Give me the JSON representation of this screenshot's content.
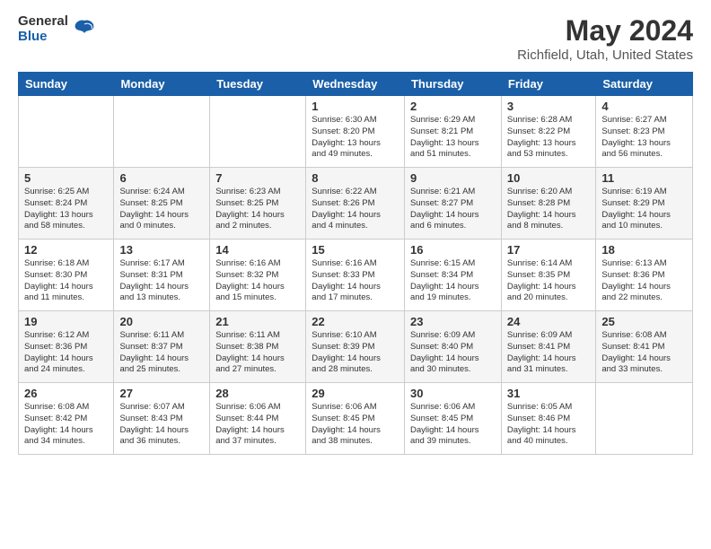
{
  "header": {
    "logo_general": "General",
    "logo_blue": "Blue",
    "month_year": "May 2024",
    "location": "Richfield, Utah, United States"
  },
  "days_of_week": [
    "Sunday",
    "Monday",
    "Tuesday",
    "Wednesday",
    "Thursday",
    "Friday",
    "Saturday"
  ],
  "weeks": [
    [
      {
        "day": "",
        "info": ""
      },
      {
        "day": "",
        "info": ""
      },
      {
        "day": "",
        "info": ""
      },
      {
        "day": "1",
        "info": "Sunrise: 6:30 AM\nSunset: 8:20 PM\nDaylight: 13 hours\nand 49 minutes."
      },
      {
        "day": "2",
        "info": "Sunrise: 6:29 AM\nSunset: 8:21 PM\nDaylight: 13 hours\nand 51 minutes."
      },
      {
        "day": "3",
        "info": "Sunrise: 6:28 AM\nSunset: 8:22 PM\nDaylight: 13 hours\nand 53 minutes."
      },
      {
        "day": "4",
        "info": "Sunrise: 6:27 AM\nSunset: 8:23 PM\nDaylight: 13 hours\nand 56 minutes."
      }
    ],
    [
      {
        "day": "5",
        "info": "Sunrise: 6:25 AM\nSunset: 8:24 PM\nDaylight: 13 hours\nand 58 minutes."
      },
      {
        "day": "6",
        "info": "Sunrise: 6:24 AM\nSunset: 8:25 PM\nDaylight: 14 hours\nand 0 minutes."
      },
      {
        "day": "7",
        "info": "Sunrise: 6:23 AM\nSunset: 8:25 PM\nDaylight: 14 hours\nand 2 minutes."
      },
      {
        "day": "8",
        "info": "Sunrise: 6:22 AM\nSunset: 8:26 PM\nDaylight: 14 hours\nand 4 minutes."
      },
      {
        "day": "9",
        "info": "Sunrise: 6:21 AM\nSunset: 8:27 PM\nDaylight: 14 hours\nand 6 minutes."
      },
      {
        "day": "10",
        "info": "Sunrise: 6:20 AM\nSunset: 8:28 PM\nDaylight: 14 hours\nand 8 minutes."
      },
      {
        "day": "11",
        "info": "Sunrise: 6:19 AM\nSunset: 8:29 PM\nDaylight: 14 hours\nand 10 minutes."
      }
    ],
    [
      {
        "day": "12",
        "info": "Sunrise: 6:18 AM\nSunset: 8:30 PM\nDaylight: 14 hours\nand 11 minutes."
      },
      {
        "day": "13",
        "info": "Sunrise: 6:17 AM\nSunset: 8:31 PM\nDaylight: 14 hours\nand 13 minutes."
      },
      {
        "day": "14",
        "info": "Sunrise: 6:16 AM\nSunset: 8:32 PM\nDaylight: 14 hours\nand 15 minutes."
      },
      {
        "day": "15",
        "info": "Sunrise: 6:16 AM\nSunset: 8:33 PM\nDaylight: 14 hours\nand 17 minutes."
      },
      {
        "day": "16",
        "info": "Sunrise: 6:15 AM\nSunset: 8:34 PM\nDaylight: 14 hours\nand 19 minutes."
      },
      {
        "day": "17",
        "info": "Sunrise: 6:14 AM\nSunset: 8:35 PM\nDaylight: 14 hours\nand 20 minutes."
      },
      {
        "day": "18",
        "info": "Sunrise: 6:13 AM\nSunset: 8:36 PM\nDaylight: 14 hours\nand 22 minutes."
      }
    ],
    [
      {
        "day": "19",
        "info": "Sunrise: 6:12 AM\nSunset: 8:36 PM\nDaylight: 14 hours\nand 24 minutes."
      },
      {
        "day": "20",
        "info": "Sunrise: 6:11 AM\nSunset: 8:37 PM\nDaylight: 14 hours\nand 25 minutes."
      },
      {
        "day": "21",
        "info": "Sunrise: 6:11 AM\nSunset: 8:38 PM\nDaylight: 14 hours\nand 27 minutes."
      },
      {
        "day": "22",
        "info": "Sunrise: 6:10 AM\nSunset: 8:39 PM\nDaylight: 14 hours\nand 28 minutes."
      },
      {
        "day": "23",
        "info": "Sunrise: 6:09 AM\nSunset: 8:40 PM\nDaylight: 14 hours\nand 30 minutes."
      },
      {
        "day": "24",
        "info": "Sunrise: 6:09 AM\nSunset: 8:41 PM\nDaylight: 14 hours\nand 31 minutes."
      },
      {
        "day": "25",
        "info": "Sunrise: 6:08 AM\nSunset: 8:41 PM\nDaylight: 14 hours\nand 33 minutes."
      }
    ],
    [
      {
        "day": "26",
        "info": "Sunrise: 6:08 AM\nSunset: 8:42 PM\nDaylight: 14 hours\nand 34 minutes."
      },
      {
        "day": "27",
        "info": "Sunrise: 6:07 AM\nSunset: 8:43 PM\nDaylight: 14 hours\nand 36 minutes."
      },
      {
        "day": "28",
        "info": "Sunrise: 6:06 AM\nSunset: 8:44 PM\nDaylight: 14 hours\nand 37 minutes."
      },
      {
        "day": "29",
        "info": "Sunrise: 6:06 AM\nSunset: 8:45 PM\nDaylight: 14 hours\nand 38 minutes."
      },
      {
        "day": "30",
        "info": "Sunrise: 6:06 AM\nSunset: 8:45 PM\nDaylight: 14 hours\nand 39 minutes."
      },
      {
        "day": "31",
        "info": "Sunrise: 6:05 AM\nSunset: 8:46 PM\nDaylight: 14 hours\nand 40 minutes."
      },
      {
        "day": "",
        "info": ""
      }
    ]
  ]
}
